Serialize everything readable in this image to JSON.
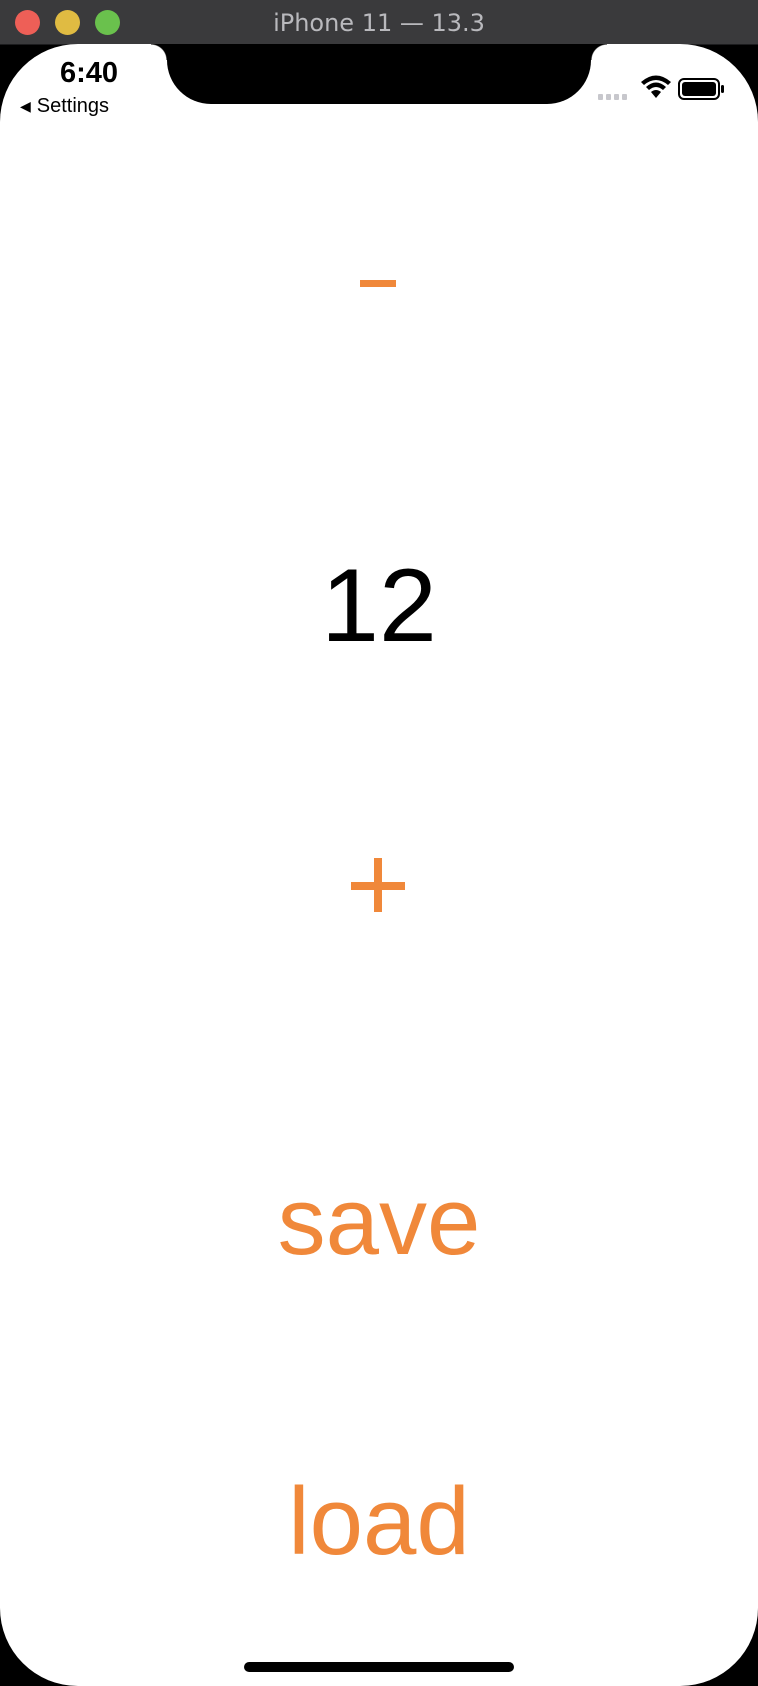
{
  "window": {
    "title": "iPhone 11 — 13.3"
  },
  "status_bar": {
    "time": "6:40",
    "back_label": "Settings",
    "back_icon": "back-triangle-icon",
    "signal_icon": "cellular-signal-icon",
    "wifi_icon": "wifi-icon",
    "battery_icon": "battery-icon"
  },
  "main": {
    "decrement_icon": "minus-icon",
    "counter_value": "12",
    "increment_icon": "plus-icon",
    "save_label": "save",
    "load_label": "load"
  },
  "colors": {
    "accent": "#f0883a",
    "text": "#000000",
    "background": "#ffffff"
  }
}
